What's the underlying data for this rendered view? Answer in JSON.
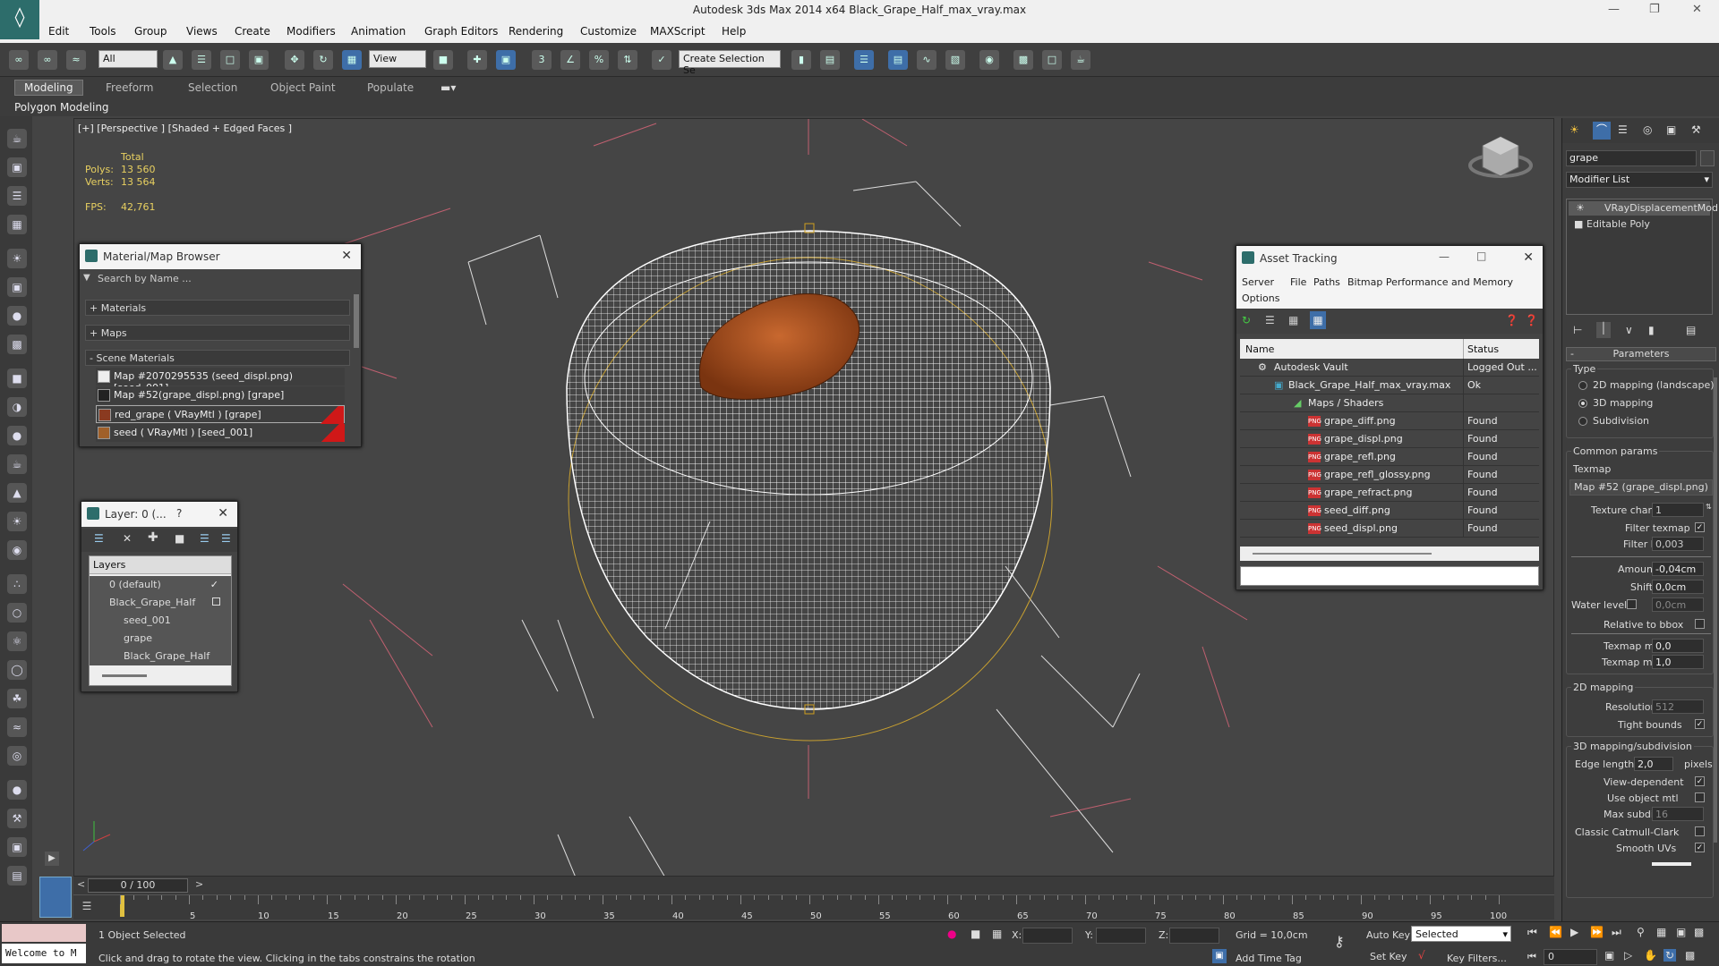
{
  "window": {
    "title": "Autodesk 3ds Max  2014 x64     Black_Grape_Half_max_vray.max",
    "logo_glyph": "◊"
  },
  "menu": [
    "Edit",
    "Tools",
    "Group",
    "Views",
    "Create",
    "Modifiers",
    "Animation",
    "Graph Editors",
    "Rendering",
    "Customize",
    "MAXScript",
    "Help"
  ],
  "toolbar": {
    "selection_filter": "All",
    "reference_coord": "View",
    "named_selection": "Create Selection Se"
  },
  "ribbon": {
    "tabs": [
      "Modeling",
      "Freeform",
      "Selection",
      "Object Paint",
      "Populate"
    ],
    "panel_label": "Polygon Modeling"
  },
  "viewport": {
    "label": "[+] [Perspective ] [Shaded + Edged Faces ]",
    "stats": {
      "total_label": "Total",
      "polys_label": "Polys:",
      "polys_value": "13 560",
      "verts_label": "Verts:",
      "verts_value": "13 564",
      "fps_label": "FPS:",
      "fps_value": "42,761"
    }
  },
  "material_browser": {
    "title": "Material/Map Browser",
    "search_placeholder": "Search by Name ...",
    "sections": [
      "+ Materials",
      "+ Maps",
      "- Scene Materials"
    ],
    "items": [
      "Map #2070295535 (seed_displ.png) [seed_001]",
      "Map #52(grape_displ.png) [grape]",
      "red_grape  ( VRayMtl )  [grape]",
      "seed  ( VRayMtl )  [seed_001]"
    ]
  },
  "layer_panel": {
    "title": "Layer: 0 (...",
    "help": "?",
    "header": "Layers",
    "rows": [
      "0 (default)",
      "Black_Grape_Half",
      "seed_001",
      "grape",
      "Black_Grape_Half"
    ]
  },
  "asset_tracking": {
    "title": "Asset Tracking",
    "menu": [
      "Server",
      "File",
      "Paths",
      "Bitmap Performance and Memory",
      "Options"
    ],
    "columns": [
      "Name",
      "Status"
    ],
    "rows": [
      {
        "name": "Autodesk Vault",
        "status": "Logged Out ..."
      },
      {
        "name": "Black_Grape_Half_max_vray.max",
        "status": "Ok"
      },
      {
        "name": "Maps / Shaders",
        "status": ""
      },
      {
        "name": "grape_diff.png",
        "status": "Found"
      },
      {
        "name": "grape_displ.png",
        "status": "Found"
      },
      {
        "name": "grape_refl.png",
        "status": "Found"
      },
      {
        "name": "grape_refl_glossy.png",
        "status": "Found"
      },
      {
        "name": "grape_refract.png",
        "status": "Found"
      },
      {
        "name": "seed_diff.png",
        "status": "Found"
      },
      {
        "name": "seed_displ.png",
        "status": "Found"
      }
    ],
    "png_badge": "PNG"
  },
  "command_panel": {
    "object_name": "grape",
    "modifier_list": "Modifier List",
    "stack": [
      "VRayDisplacementMod",
      "Editable Poly"
    ],
    "rollout": "Parameters",
    "type_label": "Type",
    "types": [
      "2D mapping (landscape)",
      "3D mapping",
      "Subdivision"
    ],
    "common_label": "Common params",
    "texmap_label": "Texmap",
    "texmap_value": "Map #52 (grape_displ.png)",
    "texture_chan_label": "Texture chan",
    "texture_chan": "1",
    "filter_texmap_label": "Filter texmap",
    "filter_blur_label": "Filter blur",
    "filter_blur": "0,003",
    "amount_label": "Amount",
    "amount": "-0,04cm",
    "shift_label": "Shift",
    "shift": "0,0cm",
    "water_label": "Water level",
    "water": "0,0cm",
    "relative_label": "Relative to bbox",
    "texmap_min_label": "Texmap min",
    "texmap_min": "0,0",
    "texmap_max_label": "Texmap max",
    "texmap_max": "1,0",
    "mapping2d_label": "2D mapping",
    "resolution_label": "Resolution",
    "resolution": "512",
    "tight_label": "Tight bounds",
    "mapping3d_label": "3D mapping/subdivision",
    "edge_label": "Edge length",
    "edge": "2,0",
    "pixels_label": "pixels",
    "view_dep_label": "View-dependent",
    "use_obj_label": "Use object mtl",
    "max_subdivs_label": "Max subdivs",
    "max_subdivs": "16",
    "classic_label": "Classic Catmull-Clark",
    "smooth_label": "Smooth UVs"
  },
  "timeline": {
    "frame": "0 / 100",
    "ticks": [
      "5",
      "10",
      "15",
      "20",
      "25",
      "30",
      "35",
      "40",
      "45",
      "50",
      "55",
      "60",
      "65",
      "70",
      "75",
      "80",
      "85",
      "90",
      "95",
      "100"
    ]
  },
  "status": {
    "welcome": "Welcome to M",
    "selected": "1 Object Selected",
    "prompt": "Click and drag to rotate the view.  Clicking in the tabs constrains the rotation",
    "x_label": "X:",
    "y_label": "Y:",
    "z_label": "Z:",
    "grid": "Grid = 10,0cm",
    "add_time_tag": "Add Time Tag",
    "auto_key": "Auto Key",
    "set_key": "Set Key",
    "selected_drop": "Selected",
    "key_filters": "Key Filters...",
    "frame_field": "0"
  }
}
